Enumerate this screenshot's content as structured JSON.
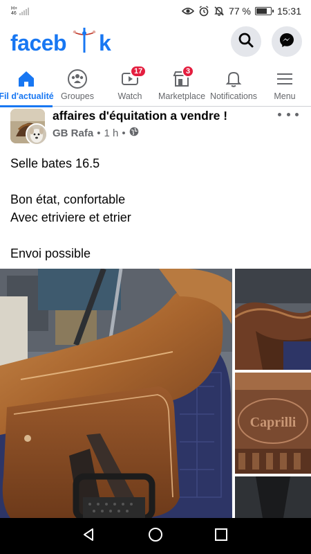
{
  "status_bar": {
    "carrier_top": "H+",
    "carrier_bottom": "46",
    "battery_percent": "77 %",
    "battery_level": 0.77,
    "time": "15:31",
    "icons": [
      "eye-icon",
      "alarm-icon",
      "bell-off-icon",
      "battery-icon"
    ]
  },
  "header": {
    "logo_left": "faceb",
    "logo_right": "k",
    "brand_color": "#1877f2",
    "icons": [
      "search-icon",
      "messenger-icon"
    ]
  },
  "tabs": [
    {
      "label": "Fil d'actualité",
      "icon": "home-icon",
      "active": true,
      "badge": ""
    },
    {
      "label": "Groupes",
      "icon": "groups-icon",
      "active": false,
      "badge": ""
    },
    {
      "label": "Watch",
      "icon": "watch-icon",
      "active": false,
      "badge": "17"
    },
    {
      "label": "Marketplace",
      "icon": "marketplace-icon",
      "active": false,
      "badge": "3"
    },
    {
      "label": "Notifications",
      "icon": "bell-icon",
      "active": false,
      "badge": ""
    },
    {
      "label": "Menu",
      "icon": "hamburger-icon",
      "active": false,
      "badge": ""
    }
  ],
  "post": {
    "group_name": "affaires d'équitation a vendre !",
    "author": "GB Rafa",
    "separator": "•",
    "time": "1 h",
    "privacy_icon": "globe-icon",
    "lines": [
      "Selle bates 16.5",
      "",
      "Bon état, confortable",
      "Avec etriviere et etrier",
      "",
      "Envoi possible"
    ],
    "photo_stamp_text": "Caprilli"
  },
  "nav": {
    "icons": [
      "back-icon",
      "home-circle-icon",
      "recents-icon"
    ]
  }
}
